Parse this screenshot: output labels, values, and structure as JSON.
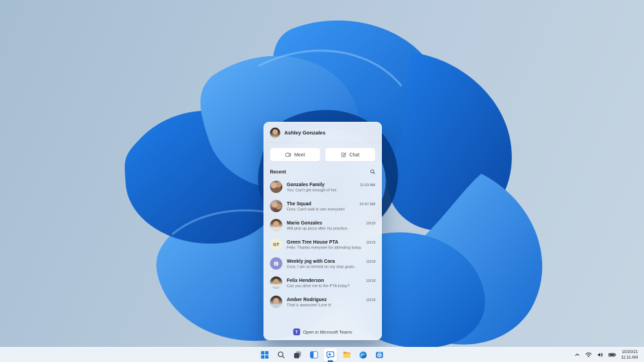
{
  "desktop": {
    "wallpaper": "windows-11-bloom",
    "background_color": "#b3c6d8",
    "bloom_accent": "#1272dc"
  },
  "teams_flyout": {
    "header": {
      "name": "Ashley Gonzales"
    },
    "actions": {
      "meet": "Meet",
      "chat": "Chat"
    },
    "recent_label": "Recent",
    "chats": [
      {
        "name": "Gonzales Family",
        "preview": "You: Can't get enough of her.",
        "time": "11:03 AM",
        "avatar": "photo-group-1"
      },
      {
        "name": "The Squad",
        "preview": "Cora: Can't wait to see everyone!",
        "time": "10:47 AM",
        "avatar": "photo-group-2"
      },
      {
        "name": "Mario Gonzales",
        "preview": "Will pick up pizza after my practice.",
        "time": "10/19",
        "avatar": "photo-man"
      },
      {
        "name": "Green Tree House PTA",
        "preview": "Felix: Thanks everyone for attending today.",
        "time": "10/19",
        "avatar": "initials",
        "initials": "GT"
      },
      {
        "name": "Weekly jog with Cora",
        "preview": "Cora: I am so behind on my step goals.",
        "time": "10/18",
        "avatar": "calendar-icon"
      },
      {
        "name": "Felix Henderson",
        "preview": "Can you drive me to the PTA today?",
        "time": "10/18",
        "avatar": "photo-man-2"
      },
      {
        "name": "Amber Rodriguez",
        "preview": "That is awesome! Love it!",
        "time": "10/18",
        "avatar": "photo-woman"
      }
    ],
    "footer": {
      "label": "Open in Microsoft Teams"
    }
  },
  "taskbar": {
    "icons": [
      "start-icon",
      "search-icon",
      "task-view-icon",
      "widgets-icon",
      "chat-icon",
      "file-explorer-icon",
      "edge-icon",
      "store-icon"
    ],
    "active_item": "chat",
    "tray_icons": [
      "chevron-up-icon",
      "wifi-icon",
      "volume-icon",
      "battery-icon"
    ],
    "tray": {
      "date": "10/20/21",
      "time": "11:11 AM"
    }
  },
  "accent_color": "#0e6ad0"
}
